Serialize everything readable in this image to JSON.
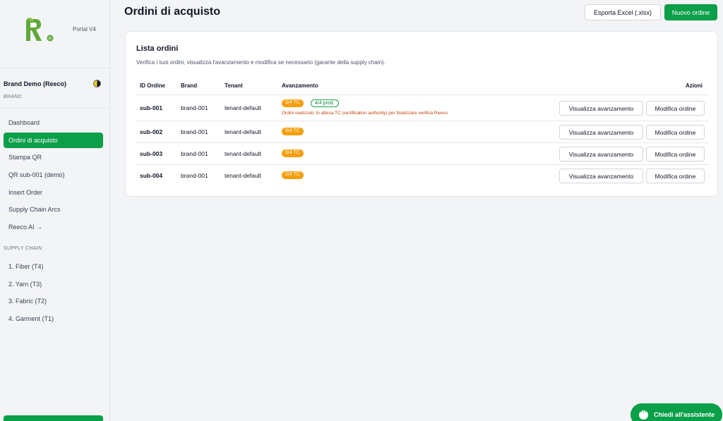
{
  "sidebar": {
    "portal_label": "Portal V4",
    "brand_name": "Brand Demo (Reeco)",
    "brand_label": "BRAND",
    "items": [
      {
        "label": "Dashboard",
        "active": false
      },
      {
        "label": "Ordini di acquisto",
        "active": true
      },
      {
        "label": "Stampa QR",
        "active": false
      },
      {
        "label": "QR sub-001 (demo)",
        "active": false
      },
      {
        "label": "Insert Order",
        "active": false
      },
      {
        "label": "Supply Chain Arcs",
        "active": false
      },
      {
        "label": "Reeco AI →",
        "active": false
      }
    ],
    "section_title": "SUPPLY CHAIN",
    "supply_items": [
      {
        "label": "1. Fiber (T4)"
      },
      {
        "label": "2. Yarn (T3)"
      },
      {
        "label": "3. Fabric (T2)"
      },
      {
        "label": "4. Garment (T1)"
      }
    ]
  },
  "header": {
    "title": "Ordini di acquisto",
    "export_label": "Esporta Excel (.xlsx)",
    "new_label": "Nuovo ordine"
  },
  "card": {
    "title": "Lista ordini",
    "subtitle": "Verifica i tuoi ordini, visualizza l'avanzamento e modifica se necessario (garante della supply chain)."
  },
  "table": {
    "headers": {
      "id": "ID Ordine",
      "brand": "Brand",
      "tenant": "Tenant",
      "progress": "Avanzamento",
      "actions": "Azioni"
    },
    "rows": [
      {
        "id": "sub-001",
        "brand": "brand-001",
        "tenant": "tenant-default",
        "tc": "0/4 TC",
        "prod": "4/4 prod.",
        "note": "Ordini realizzati. In attesa TC (certification authority) per finalizzare verifica Reeco.",
        "view": "Visualizza avanzamento",
        "edit": "Modifica ordine"
      },
      {
        "id": "sub-002",
        "brand": "brand-001",
        "tenant": "tenant-default",
        "tc": "0/4 TC",
        "view": "Visualizza avanzamento",
        "edit": "Modifica ordine"
      },
      {
        "id": "sub-003",
        "brand": "brand-001",
        "tenant": "tenant-default",
        "tc": "0/4 TC",
        "view": "Visualizza avanzamento",
        "edit": "Modifica ordine"
      },
      {
        "id": "sub-004",
        "brand": "brand-001",
        "tenant": "tenant-default",
        "tc": "0/4 TC",
        "view": "Visualizza avanzamento",
        "edit": "Modifica ordine"
      }
    ]
  },
  "assistant": {
    "label": "Chiedi all'assistente"
  },
  "colors": {
    "accent": "#0a9f48",
    "badge_orange": "#f59e0b",
    "note_text": "#c2410c"
  },
  "icons": [
    "reeco-logo",
    "theme-toggle-icon",
    "chat-icon"
  ]
}
